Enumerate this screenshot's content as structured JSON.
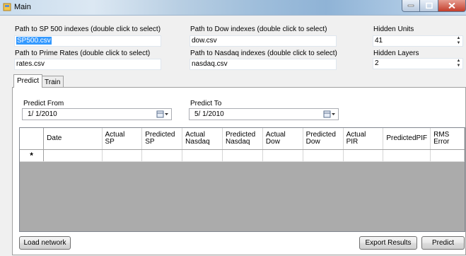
{
  "window": {
    "title": "Main"
  },
  "form": {
    "sp_path_label": "Path to SP 500 indexes (double click to select)",
    "sp_path_value": "SP500.csv",
    "prime_path_label": "Path to Prime Rates (double click to select)",
    "prime_path_value": "rates.csv",
    "dow_path_label": "Path to Dow indexes (double click to select)",
    "dow_path_value": "dow.csv",
    "nasdaq_path_label": "Path to Nasdaq indexes (double click to select)",
    "nasdaq_path_value": "nasdaq.csv",
    "hidden_units_label": "Hidden Units",
    "hidden_units_value": "41",
    "hidden_layers_label": "Hidden Layers",
    "hidden_layers_value": "2"
  },
  "tabs": [
    {
      "label": "Predict",
      "active": true
    },
    {
      "label": "Train",
      "active": false
    }
  ],
  "predict": {
    "from_label": "Predict From",
    "from_value": "1/ 1/2010",
    "to_label": "Predict To",
    "to_value": "5/ 1/2010"
  },
  "grid": {
    "columns": [
      [
        "Date"
      ],
      [
        "Actual",
        "SP"
      ],
      [
        "Predicted",
        "SP"
      ],
      [
        "Actual",
        "Nasdaq"
      ],
      [
        "Predicted",
        "Nasdaq"
      ],
      [
        "Actual",
        "Dow"
      ],
      [
        "Predicted",
        "Dow"
      ],
      [
        "Actual",
        "PIR"
      ],
      [
        "PredictedPIF"
      ],
      [
        "RMS",
        "Error"
      ]
    ],
    "new_row_marker": "*"
  },
  "buttons": {
    "load_network": "Load network",
    "export_results": "Export Results",
    "predict": "Predict"
  },
  "colors": {
    "selection": "#3399ff",
    "grid_background": "#ababab",
    "close_button": "#c43d2b"
  }
}
